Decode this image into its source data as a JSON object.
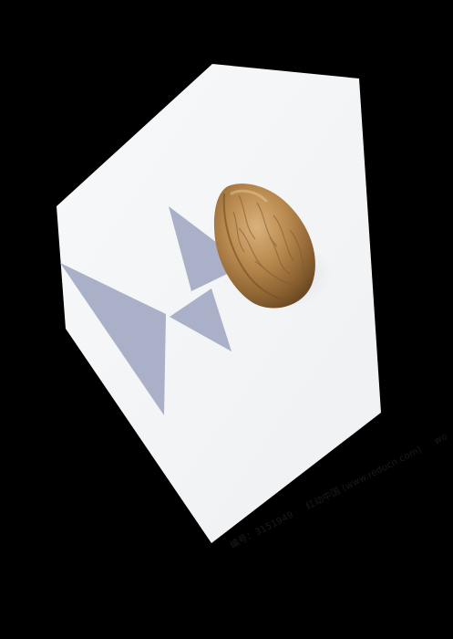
{
  "photo": {
    "subject": "walnut",
    "background_color": "#f6f7f8",
    "overlay_color": "#aab0c8",
    "frame_color": "#000000"
  },
  "watermark": {
    "id_label": "编号：3151949",
    "site_label": "红动中国 (www.redocn.com)",
    "trailing": "wo"
  }
}
